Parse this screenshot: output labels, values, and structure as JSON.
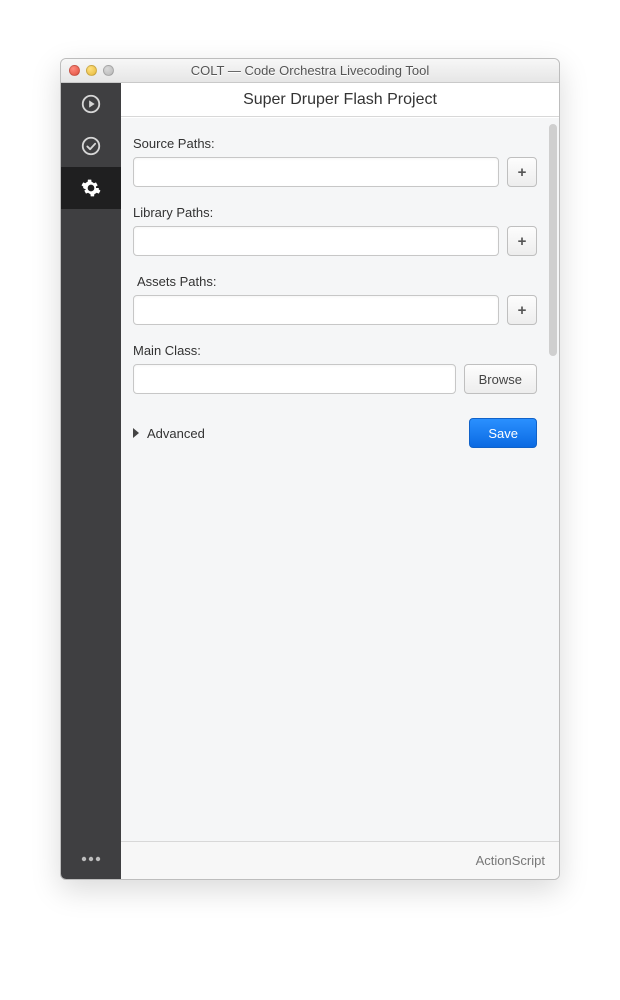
{
  "window": {
    "title": "COLT — Code Orchestra Livecoding Tool"
  },
  "header": {
    "project_name": "Super Druper Flash Project"
  },
  "sidebar": {
    "items": [
      {
        "name": "play-icon"
      },
      {
        "name": "check-icon"
      },
      {
        "name": "gear-icon"
      }
    ],
    "more_label": "more-icon"
  },
  "form": {
    "source_paths": {
      "label": "Source Paths:",
      "value": "",
      "add_label": "+"
    },
    "library_paths": {
      "label": "Library Paths:",
      "value": "",
      "add_label": "+"
    },
    "assets_paths": {
      "label": "Assets Paths:",
      "value": "",
      "add_label": "+"
    },
    "main_class": {
      "label": "Main Class:",
      "value": "",
      "browse_label": "Browse"
    },
    "advanced_label": "Advanced",
    "save_label": "Save"
  },
  "statusbar": {
    "language": "ActionScript"
  }
}
